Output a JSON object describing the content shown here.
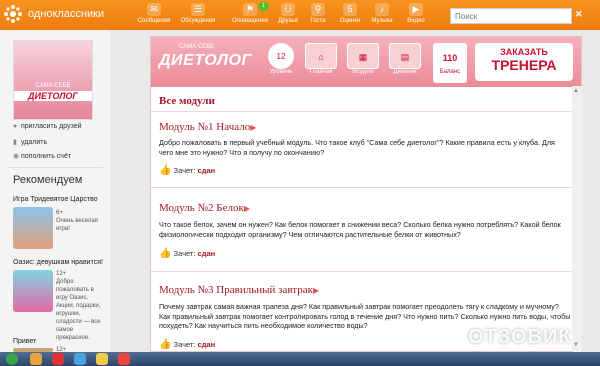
{
  "header": {
    "site_name": "одноклассники",
    "search_placeholder": "Поиск",
    "close_glyph": "✕",
    "nav": [
      {
        "icon": "envelope-icon",
        "glyph": "✉",
        "label": "Сообщения"
      },
      {
        "icon": "chat-icon",
        "glyph": "☰",
        "label": "Обсуждения"
      },
      {
        "icon": "bell-icon",
        "glyph": "⚑",
        "label": "Оповещения",
        "badge": "1"
      },
      {
        "icon": "group-icon",
        "glyph": "⚇",
        "label": "Друзья"
      },
      {
        "icon": "footprints-icon",
        "glyph": "⚲",
        "label": "Гости"
      },
      {
        "icon": "star-icon",
        "glyph": "5",
        "label": "Оценки"
      },
      {
        "icon": "music-icon",
        "glyph": "♪",
        "label": "Музыка"
      },
      {
        "icon": "video-icon",
        "glyph": "▶",
        "label": "Видео"
      }
    ]
  },
  "sidebar": {
    "avatar_top": "САМА СЕБЕ",
    "avatar_main": "ДИЕТОЛОГ",
    "actions": [
      {
        "icon": "person-icon",
        "glyph": "●",
        "label": "пригласить друзей"
      },
      {
        "icon": "trash-icon",
        "glyph": "▮",
        "label": "удалить"
      },
      {
        "icon": "coin-icon",
        "glyph": "◉",
        "label": "пополнить счёт"
      }
    ],
    "rec_title": "Рекомендуем",
    "recs": [
      {
        "name": "Игра Тридевятое Царство",
        "desc": "6+\nОчень веселая игра!"
      },
      {
        "name": "Оазис: девушкам нравится!",
        "desc": "12+\nДобро пожаловать в игру Оазис. Акции, подарки, игрушки, сладости — все самое прекрасное."
      },
      {
        "name": "Привет",
        "desc": "12+"
      }
    ]
  },
  "banner": {
    "small": "САМА СЕБЕ",
    "big": "ДИЕТОЛОГ",
    "level_value": "12",
    "level_label": "Уровень",
    "buttons": [
      {
        "icon": "home-icon",
        "glyph": "⌂",
        "label": "Главная"
      },
      {
        "icon": "modules-icon",
        "glyph": "▦",
        "label": "Модули"
      },
      {
        "icon": "diary-icon",
        "glyph": "▤",
        "label": "Дневник"
      }
    ],
    "balance_value": "110",
    "balance_label": "Баланс",
    "trainer_a": "ЗАКАЗАТЬ",
    "trainer_b": "ТРЕНЕРА"
  },
  "content": {
    "all_title": "Все модули",
    "test_label": "Зачет:",
    "arrow_glyph": "▶",
    "hand_glyph": "👍",
    "modules": [
      {
        "title": "Модуль №1 Начало",
        "text": "Добро пожаловать в первый учебный модуль. Что такое клуб \"Сама себе диетолог\"? Какие правила есть у клуба. Для чего мне это нужно? Что я получу по окончанию?",
        "status": "сдан"
      },
      {
        "title": "Модуль №2 Белок",
        "text": "Что такое белок, зачем он нужен? Как белок помогает в снижении веса? Сколько белка нужно потреблять? Какой белок физиологически подходит организму? Чем отличаются растительные белки от животных?",
        "status": "сдан"
      },
      {
        "title": "Модуль №3 Правильный завтрак",
        "text": "Почему завтрак самая важная трапеза дня? Как правильный завтрак помогает преодолеть тягу к сладкому и мучному? Как правильный завтрак помогает контролировать голод в течение дня? Что нужно пить? Сколько нужно пить воды, чтобы похудеть? Как научиться пить необходимое количество воды?",
        "status": "сдан"
      }
    ]
  },
  "watermark": "ОТЗОВИК",
  "colors": {
    "orange": "#f7931e",
    "accent": "#a31a26",
    "pink": "#ea8b98"
  }
}
